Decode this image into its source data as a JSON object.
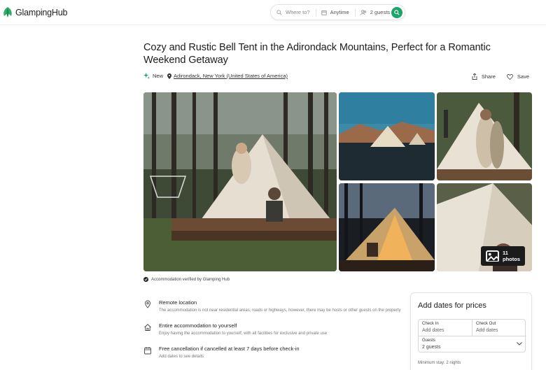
{
  "header": {
    "logo_text": "GlampingHub",
    "search": {
      "where": "Where to?",
      "when": "Anytime",
      "guests": "2 guests"
    }
  },
  "listing": {
    "title": "Cozy and Rustic Bell Tent in the Adirondack Mountains, Perfect for a Romantic Weekend Getaway",
    "badge": "New",
    "location": "Adirondack, New York (United States of America)",
    "share_label": "Share",
    "save_label": "Save"
  },
  "gallery": {
    "photos_label": "11 photos",
    "verified_text": "Accommodation verified by Glamping Hub"
  },
  "features": [
    {
      "icon": "location-pin-icon",
      "title": "Remote location",
      "desc": "The accommodation is not near residential areas, roads or highways, however, there may be hosts or other guests on the property"
    },
    {
      "icon": "home-icon",
      "title": "Entire accommodation to yourself",
      "desc": "Enjoy having the accommodation to yourself; with all facilities for exclusive and private use"
    },
    {
      "icon": "calendar-icon",
      "title": "Free cancellation if cancelled at least 7 days before check-in",
      "desc": "Add dates to see details"
    }
  ],
  "booking": {
    "title": "Add dates for prices",
    "check_in_label": "Check In",
    "check_in_value": "Add dates",
    "check_out_label": "Check Out",
    "check_out_value": "Add dates",
    "guests_label": "Guests",
    "guests_value": "2 guests",
    "min_stay": "Minimum stay: 2 nights"
  },
  "colors": {
    "brand_green": "#1aa56b",
    "dark_button": "#1b1b1b"
  }
}
